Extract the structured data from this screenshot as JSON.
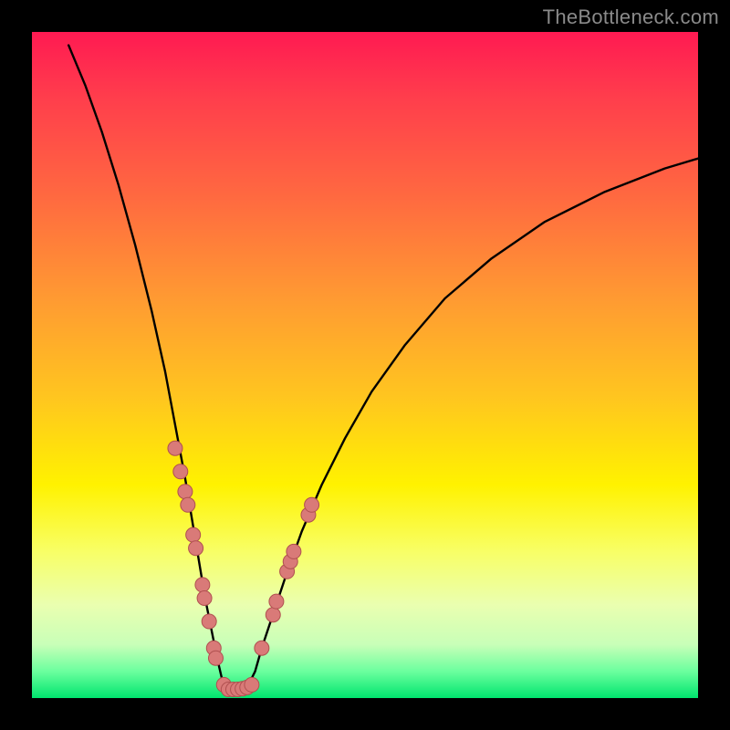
{
  "watermark": {
    "text": "TheBottleneck.com"
  },
  "colors": {
    "bg": "#000000",
    "curve": "#000000",
    "dot_fill": "#d97a78",
    "dot_stroke": "#b05050"
  },
  "chart_data": {
    "type": "line",
    "title": "",
    "xlabel": "",
    "ylabel": "",
    "xlim": [
      0,
      100
    ],
    "ylim": [
      0,
      100
    ],
    "grid": false,
    "legend": false,
    "description": "V-shaped bottleneck curve over a vertical rainbow gradient where y=0 (bottom, green) is optimal and y=100 (top, red) is worst. Minimum near x≈29.",
    "curve_points": [
      {
        "x": 5.5,
        "y": 98
      },
      {
        "x": 8.0,
        "y": 92
      },
      {
        "x": 10.5,
        "y": 85
      },
      {
        "x": 13.0,
        "y": 77
      },
      {
        "x": 15.5,
        "y": 68
      },
      {
        "x": 18.0,
        "y": 58
      },
      {
        "x": 20.0,
        "y": 49
      },
      {
        "x": 21.5,
        "y": 41
      },
      {
        "x": 23.0,
        "y": 33
      },
      {
        "x": 24.0,
        "y": 27
      },
      {
        "x": 25.0,
        "y": 21
      },
      {
        "x": 26.0,
        "y": 15
      },
      {
        "x": 27.0,
        "y": 10
      },
      {
        "x": 27.8,
        "y": 6
      },
      {
        "x": 28.5,
        "y": 3
      },
      {
        "x": 29.3,
        "y": 1.2
      },
      {
        "x": 30.2,
        "y": 1.2
      },
      {
        "x": 31.0,
        "y": 1.3
      },
      {
        "x": 31.8,
        "y": 1.5
      },
      {
        "x": 32.6,
        "y": 2.2
      },
      {
        "x": 33.5,
        "y": 4.0
      },
      {
        "x": 34.5,
        "y": 7.5
      },
      {
        "x": 36.0,
        "y": 12
      },
      {
        "x": 38.0,
        "y": 18
      },
      {
        "x": 40.5,
        "y": 25
      },
      {
        "x": 43.5,
        "y": 32
      },
      {
        "x": 47.0,
        "y": 39
      },
      {
        "x": 51.0,
        "y": 46
      },
      {
        "x": 56.0,
        "y": 53
      },
      {
        "x": 62.0,
        "y": 60
      },
      {
        "x": 69.0,
        "y": 66
      },
      {
        "x": 77.0,
        "y": 71.5
      },
      {
        "x": 86.0,
        "y": 76
      },
      {
        "x": 95.0,
        "y": 79.5
      },
      {
        "x": 100.0,
        "y": 81
      }
    ],
    "dots": [
      {
        "x": 21.5,
        "y": 37.5
      },
      {
        "x": 22.3,
        "y": 34.0
      },
      {
        "x": 23.0,
        "y": 31.0
      },
      {
        "x": 23.4,
        "y": 29.0
      },
      {
        "x": 24.2,
        "y": 24.5
      },
      {
        "x": 24.6,
        "y": 22.5
      },
      {
        "x": 25.6,
        "y": 17.0
      },
      {
        "x": 25.9,
        "y": 15.0
      },
      {
        "x": 26.6,
        "y": 11.5
      },
      {
        "x": 27.3,
        "y": 7.5
      },
      {
        "x": 27.6,
        "y": 6.0
      },
      {
        "x": 28.8,
        "y": 2.0
      },
      {
        "x": 29.5,
        "y": 1.3
      },
      {
        "x": 30.2,
        "y": 1.3
      },
      {
        "x": 30.9,
        "y": 1.3
      },
      {
        "x": 31.6,
        "y": 1.4
      },
      {
        "x": 32.3,
        "y": 1.6
      },
      {
        "x": 33.0,
        "y": 2.0
      },
      {
        "x": 34.5,
        "y": 7.5
      },
      {
        "x": 36.2,
        "y": 12.5
      },
      {
        "x": 36.7,
        "y": 14.5
      },
      {
        "x": 38.3,
        "y": 19.0
      },
      {
        "x": 38.8,
        "y": 20.5
      },
      {
        "x": 39.3,
        "y": 22.0
      },
      {
        "x": 41.5,
        "y": 27.5
      },
      {
        "x": 42.0,
        "y": 29.0
      }
    ]
  }
}
